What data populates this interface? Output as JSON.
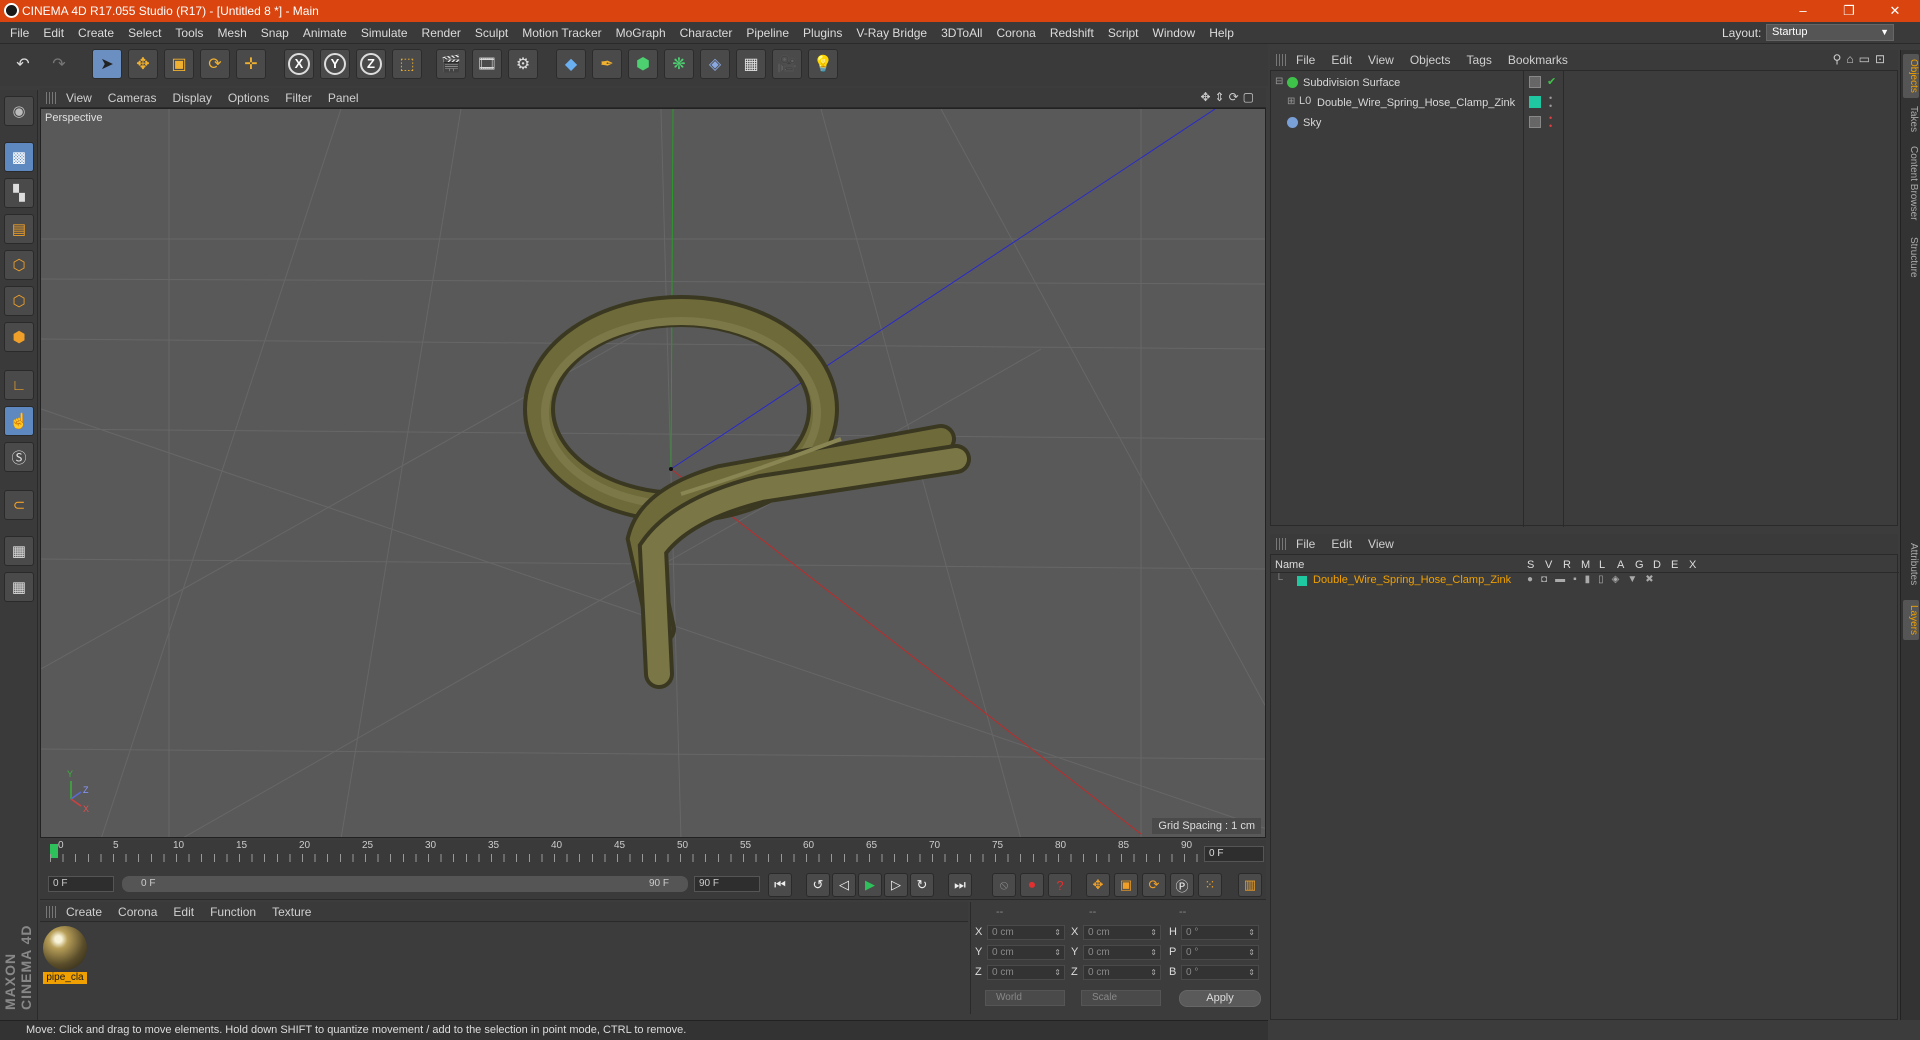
{
  "window": {
    "title": "CINEMA 4D R17.055 Studio (R17) - [Untitled 8 *] - Main",
    "minimize": "–",
    "restore": "❐",
    "close": "✕"
  },
  "menubar": {
    "items": [
      "File",
      "Edit",
      "Create",
      "Select",
      "Tools",
      "Mesh",
      "Snap",
      "Animate",
      "Simulate",
      "Render",
      "Sculpt",
      "Motion Tracker",
      "MoGraph",
      "Character",
      "Pipeline",
      "Plugins",
      "V-Ray Bridge",
      "3DToAll",
      "Corona",
      "Redshift",
      "Script",
      "Window",
      "Help"
    ],
    "layout_label": "Layout:",
    "layout_value": "Startup"
  },
  "toolbar": {
    "axis_x": "X",
    "axis_y": "Y",
    "axis_z": "Z"
  },
  "viewport": {
    "menu": [
      "View",
      "Cameras",
      "Display",
      "Options",
      "Filter",
      "Panel"
    ],
    "label": "Perspective",
    "grid_spacing": "Grid Spacing : 1 cm",
    "axis_indicator": {
      "y": "Y",
      "z": "Z",
      "x": "X"
    }
  },
  "timeline": {
    "ticks": [
      "0",
      "5",
      "10",
      "15",
      "20",
      "25",
      "30",
      "35",
      "40",
      "45",
      "50",
      "55",
      "60",
      "65",
      "70",
      "75",
      "80",
      "85",
      "90"
    ],
    "current_frame": "0 F"
  },
  "transport": {
    "start_field": "0 F",
    "range_start": "0 F",
    "range_end": "90 F",
    "end_field": "90 F"
  },
  "material_manager": {
    "menu": [
      "Create",
      "Corona",
      "Edit",
      "Function",
      "Texture"
    ],
    "materials": [
      {
        "name": "pipe_cla"
      }
    ]
  },
  "coordinates": {
    "headers": [
      "--",
      "--",
      "--"
    ],
    "rows": [
      {
        "a_label": "X",
        "a_val": "0 cm",
        "b_label": "X",
        "b_val": "0 cm",
        "c_label": "H",
        "c_val": "0 °"
      },
      {
        "a_label": "Y",
        "a_val": "0 cm",
        "b_label": "Y",
        "b_val": "0 cm",
        "c_label": "P",
        "c_val": "0 °"
      },
      {
        "a_label": "Z",
        "a_val": "0 cm",
        "b_label": "Z",
        "b_val": "0 cm",
        "c_label": "B",
        "c_val": "0 °"
      }
    ],
    "space_select": "World",
    "mode_select": "Scale",
    "apply": "Apply"
  },
  "status": {
    "text": "Move: Click and drag to move elements. Hold down SHIFT to quantize movement / add to the selection in point mode, CTRL to remove."
  },
  "object_manager": {
    "menu": [
      "File",
      "Edit",
      "View",
      "Objects",
      "Tags",
      "Bookmarks"
    ],
    "objects": [
      {
        "name": "Subdivision Surface",
        "color": "#3fc24a"
      },
      {
        "name": "Double_Wire_Spring_Hose_Clamp_Zink",
        "color": "#cfcfcf"
      },
      {
        "name": "Sky",
        "color": "#7aa0d8"
      }
    ]
  },
  "layer_manager": {
    "menu": [
      "File",
      "Edit",
      "View"
    ],
    "columns": [
      "Name",
      "S",
      "V",
      "R",
      "M",
      "L",
      "A",
      "G",
      "D",
      "E",
      "X"
    ],
    "layers": [
      {
        "name": "Double_Wire_Spring_Hose_Clamp_Zink",
        "color": "#1fc8a0"
      }
    ]
  },
  "right_tabs": [
    "Objects",
    "Takes",
    "Content Browser",
    "Structure",
    "Attributes",
    "Layers"
  ],
  "branding": {
    "maxon": "MAXON CINEMA 4D"
  },
  "colors": {
    "accent": "#d9440f",
    "highlight": "#f0a000",
    "viewport_bg": "#595959"
  }
}
